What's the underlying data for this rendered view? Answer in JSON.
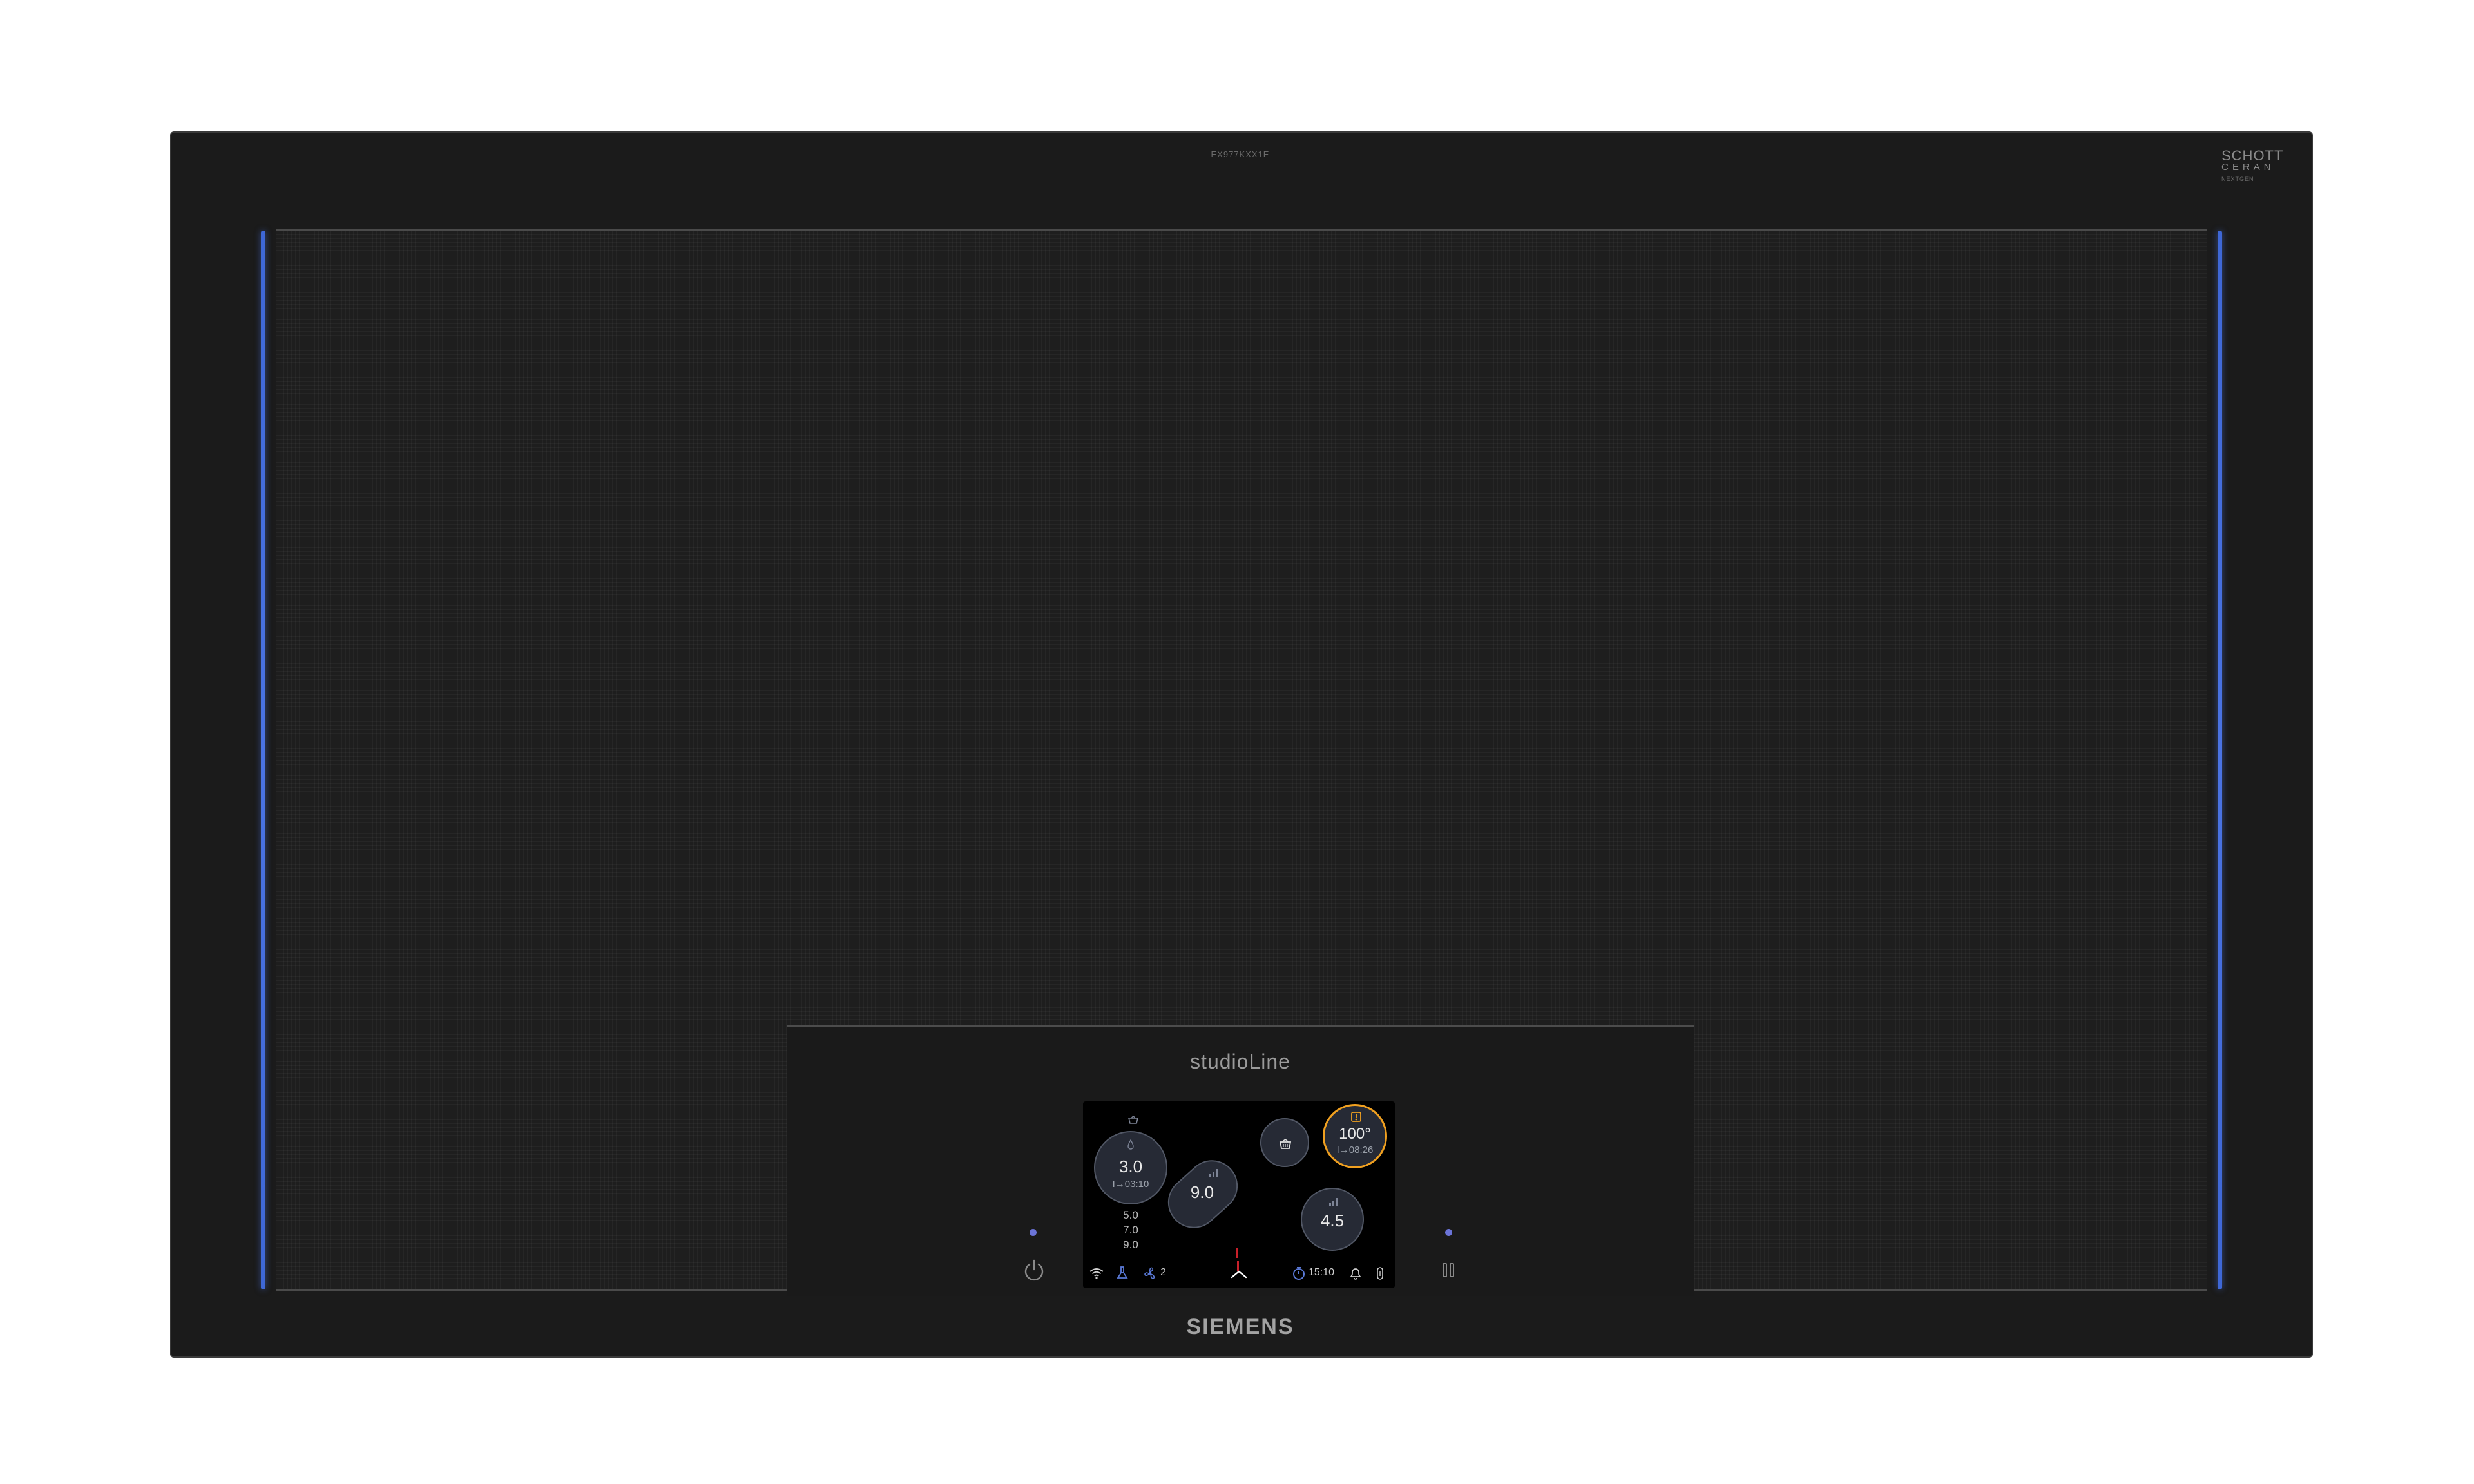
{
  "product": {
    "model_number": "EX977KXX1E",
    "line_label": "studioLine",
    "brand": "SIEMENS",
    "glass_brand": {
      "line1": "SCHOTT",
      "line2": "CERAN",
      "line3": "NEXTGEN"
    }
  },
  "colors": {
    "body": "#1b1b1b",
    "side_light": "#4a73e3",
    "highlight_ring": "#f0a020",
    "indicator_dot": "#6b74d8"
  },
  "controls": {
    "power_icon": "power-icon",
    "pause_icon": "pause-icon"
  },
  "display": {
    "zones": [
      {
        "id": "front-left",
        "level": "3.0",
        "timer": "I→03:10",
        "top_icon": "basket-icon",
        "secondary_icon": "pot-icon"
      },
      {
        "id": "center",
        "level": "9.0",
        "top_icon": "level-bars-icon"
      },
      {
        "id": "top-center",
        "top_icon": "level-bars-icon",
        "main_icon": "frying-basket-icon"
      },
      {
        "id": "top-right",
        "temperature": "100°",
        "timer": "I→08:26",
        "top_icon": "pan-sensor-icon",
        "highlighted": true
      },
      {
        "id": "right",
        "level": "4.5",
        "top_icon": "level-bars-icon"
      }
    ],
    "level_stack": [
      "5.0",
      "7.0",
      "9.0"
    ],
    "status_bar": {
      "wifi_icon": "wifi-icon",
      "hood_icon": "hood-icon",
      "fan_icon": "fan-icon",
      "fan_level": "2",
      "expand_icon": "chevron-up-icon",
      "timer_icon": "stopwatch-icon",
      "clock": "15:10",
      "bell_icon": "bell-icon",
      "lock_icon": "child-lock-icon"
    }
  }
}
